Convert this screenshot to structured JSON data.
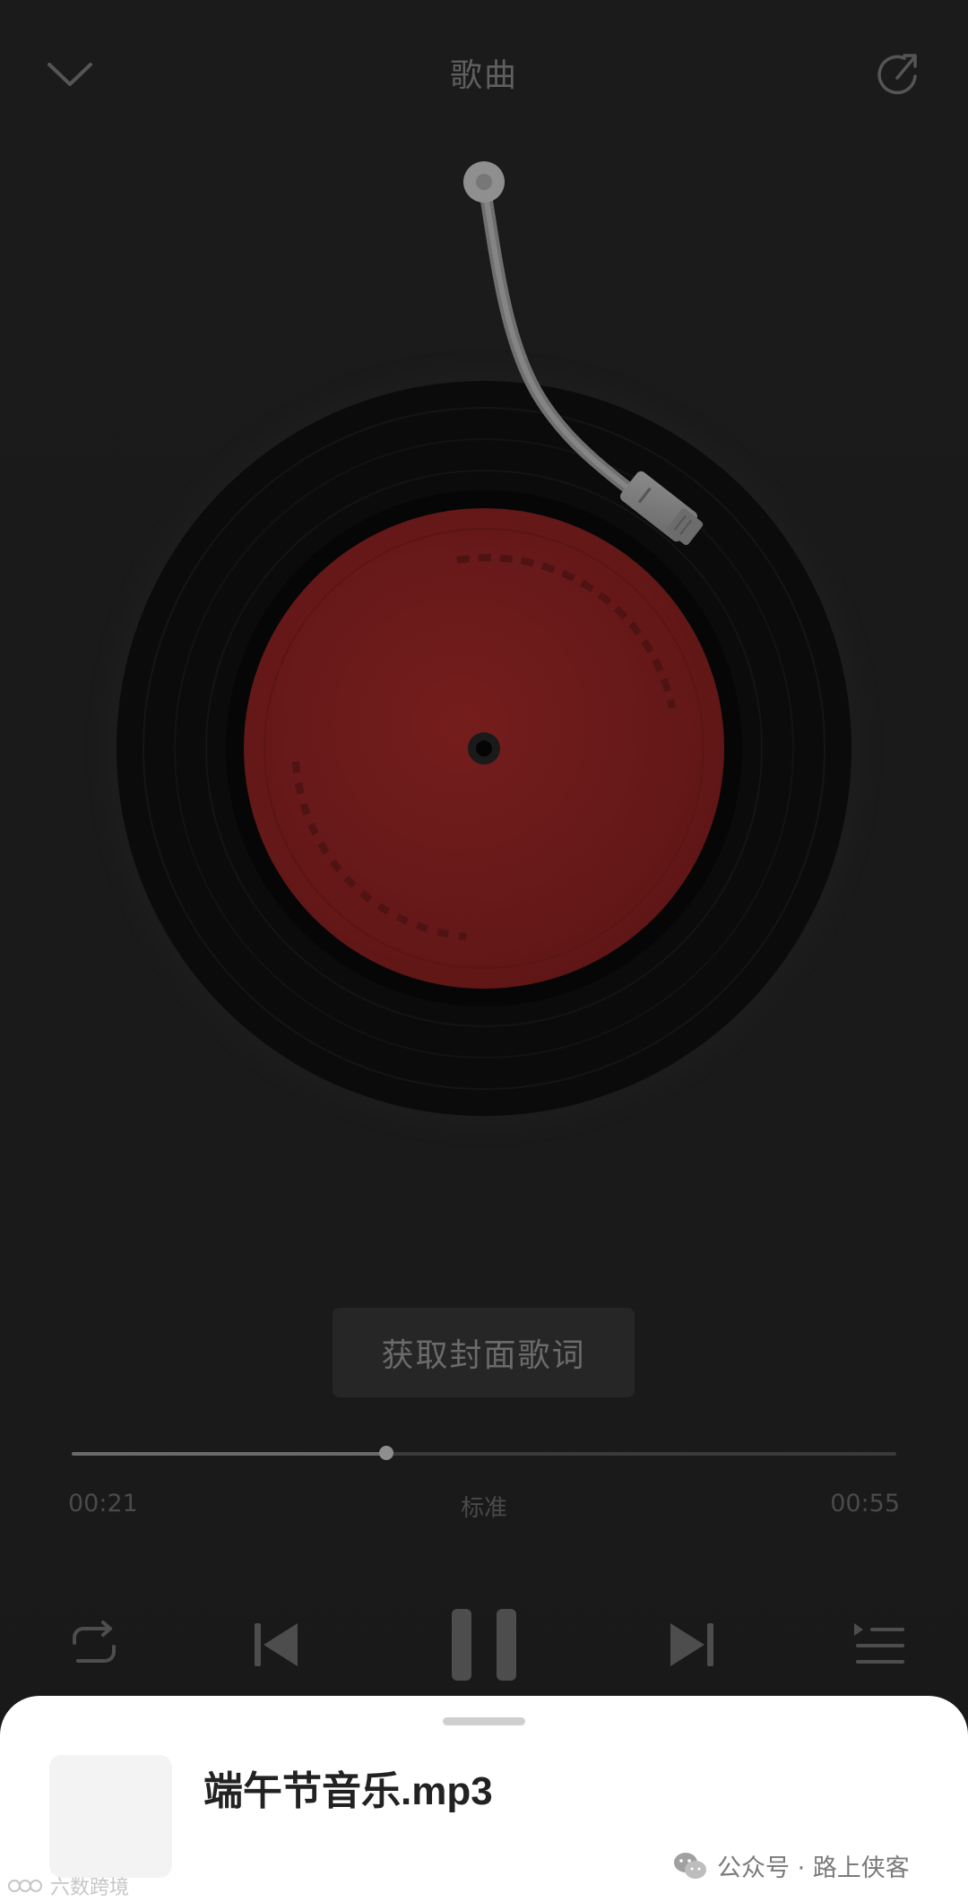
{
  "header": {
    "title": "歌曲",
    "back_icon": "chevron-down-icon",
    "share_icon": "share-icon"
  },
  "record": {
    "label_color": "#6b1a1a",
    "disc_color": "#0b0b0b"
  },
  "cover_button": {
    "label": "获取封面歌词"
  },
  "playback": {
    "current_time": "00:21",
    "total_time": "00:55",
    "quality": "标准",
    "progress": 0.3818
  },
  "controls": {
    "repeat_icon": "repeat-icon",
    "prev_icon": "previous-icon",
    "pause_icon": "pause-icon",
    "next_icon": "next-icon",
    "playlist_icon": "playlist-icon"
  },
  "sheet": {
    "file_name": "端午节音乐.mp3"
  },
  "watermarks": {
    "right": "公众号 · 路上侠客",
    "left": "六数跨境"
  }
}
